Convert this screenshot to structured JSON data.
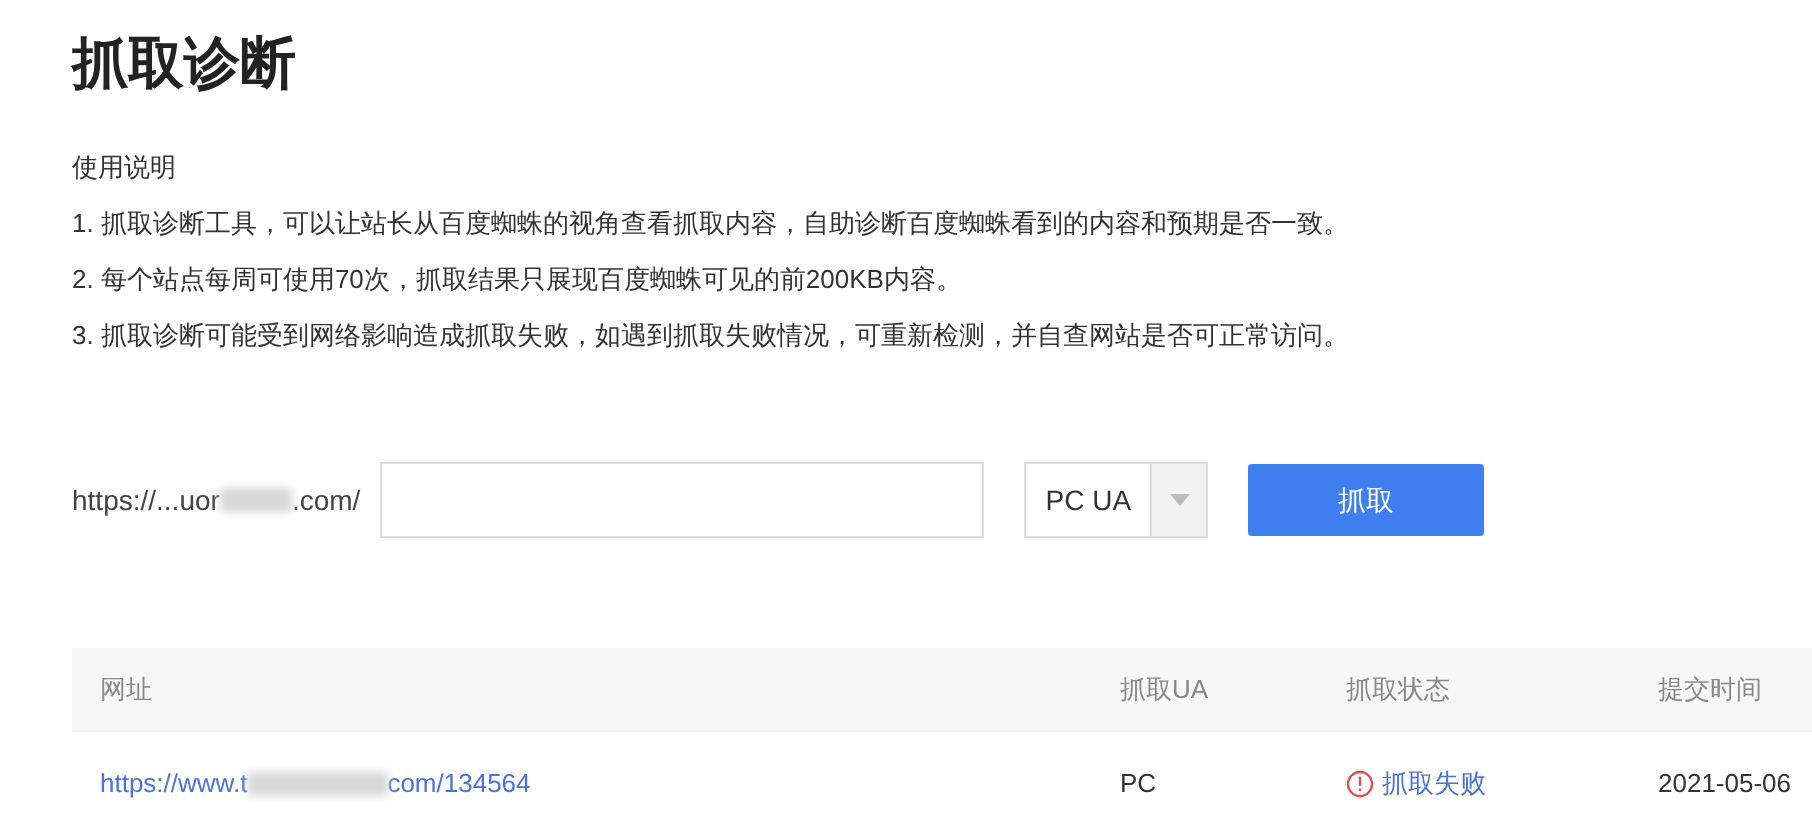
{
  "title": "抓取诊断",
  "instructions": {
    "heading": "使用说明",
    "items": [
      "1. 抓取诊断工具，可以让站长从百度蜘蛛的视角查看抓取内容，自助诊断百度蜘蛛看到的内容和预期是否一致。",
      "2. 每个站点每周可使用70次，抓取结果只展现百度蜘蛛可见的前200KB内容。",
      "3. 抓取诊断可能受到网络影响造成抓取失败，如遇到抓取失败情况，可重新检测，并自查网站是否可正常访问。"
    ]
  },
  "form": {
    "url_prefix": {
      "before_redaction": "https://...uor",
      "after_redaction": ".com/"
    },
    "ua_select": "PC UA",
    "submit_button": "抓取"
  },
  "table": {
    "columns": [
      "网址",
      "抓取UA",
      "抓取状态",
      "提交时间"
    ],
    "rows": [
      {
        "url": {
          "before_redaction": "https://www.t",
          "after_redaction": "com/134564"
        },
        "ua": "PC",
        "status": {
          "kind": "failed",
          "label": "抓取失败"
        },
        "time": "2021-05-06"
      }
    ]
  }
}
